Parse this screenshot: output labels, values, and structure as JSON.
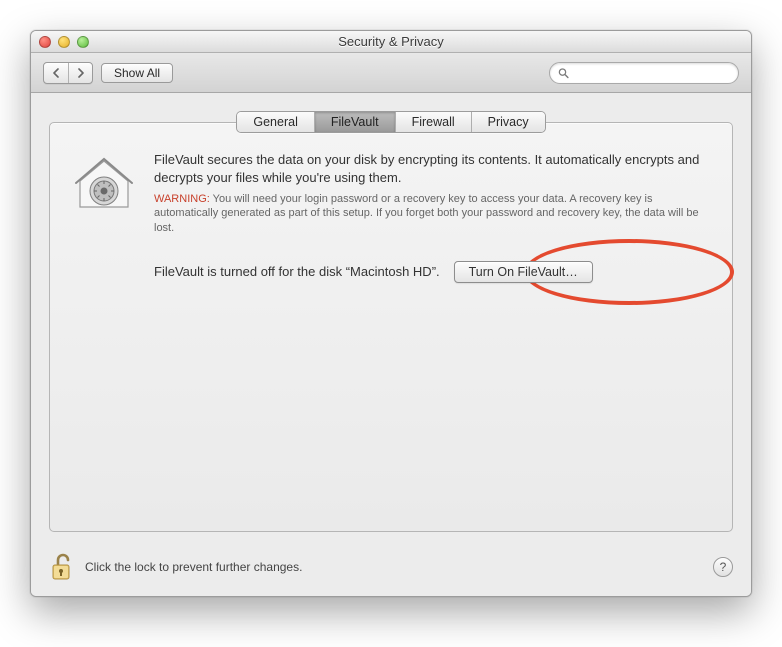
{
  "window": {
    "title": "Security & Privacy"
  },
  "toolbar": {
    "show_all_label": "Show All",
    "search_placeholder": ""
  },
  "tabs": {
    "items": [
      {
        "label": "General"
      },
      {
        "label": "FileVault"
      },
      {
        "label": "Firewall"
      },
      {
        "label": "Privacy"
      }
    ],
    "active_index": 1
  },
  "filevault": {
    "description": "FileVault secures the data on your disk by encrypting its contents. It automatically encrypts and decrypts your files while you're using them.",
    "warning_label": "WARNING:",
    "warning_text": "You will need your login password or a recovery key to access your data. A recovery key is automatically generated as part of this setup. If you forget both your password and recovery key, the data will be lost.",
    "status_text": "FileVault is turned off for the disk “Macintosh HD”.",
    "turn_on_label": "Turn On FileVault…"
  },
  "footer": {
    "lock_text": "Click the lock to prevent further changes."
  },
  "annotation": {
    "color": "#e44a2f"
  }
}
